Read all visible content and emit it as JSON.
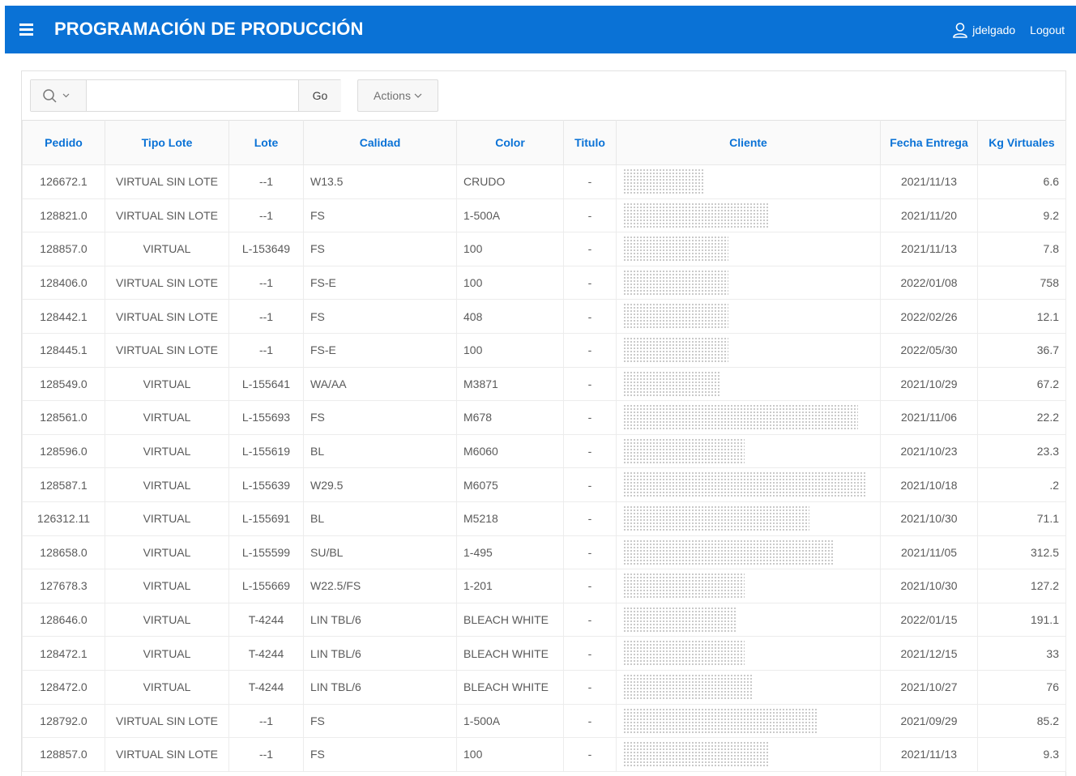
{
  "header": {
    "title": "PROGRAMACIÓN DE PRODUCCIÓN",
    "username": "jdelgado",
    "logout_label": "Logout"
  },
  "toolbar": {
    "search_value": "",
    "go_label": "Go",
    "actions_label": "Actions"
  },
  "table": {
    "columns": [
      "Pedido",
      "Tipo Lote",
      "Lote",
      "Calidad",
      "Color",
      "Titulo",
      "Cliente",
      "Fecha Entrega",
      "Kg Virtuales"
    ],
    "rows": [
      [
        "126672.1",
        "VIRTUAL SIN LOTE",
        "--1",
        "W13.5",
        "CRUDO",
        "-",
        "",
        "2021/11/13",
        "6.6"
      ],
      [
        "128821.0",
        "VIRTUAL SIN LOTE",
        "--1",
        "FS",
        "1-500A",
        "-",
        "",
        "2021/11/20",
        "9.2"
      ],
      [
        "128857.0",
        "VIRTUAL",
        "L-153649",
        "FS",
        "100",
        "-",
        "",
        "2021/11/13",
        "7.8"
      ],
      [
        "128406.0",
        "VIRTUAL SIN LOTE",
        "--1",
        "FS-E",
        "100",
        "-",
        "",
        "2022/01/08",
        "758"
      ],
      [
        "128442.1",
        "VIRTUAL SIN LOTE",
        "--1",
        "FS",
        "408",
        "-",
        "",
        "2022/02/26",
        "12.1"
      ],
      [
        "128445.1",
        "VIRTUAL SIN LOTE",
        "--1",
        "FS-E",
        "100",
        "-",
        "",
        "2022/05/30",
        "36.7"
      ],
      [
        "128549.0",
        "VIRTUAL",
        "L-155641",
        "WA/AA",
        "M3871",
        "-",
        "",
        "2021/10/29",
        "67.2"
      ],
      [
        "128561.0",
        "VIRTUAL",
        "L-155693",
        "FS",
        "M678",
        "-",
        "",
        "2021/11/06",
        "22.2"
      ],
      [
        "128596.0",
        "VIRTUAL",
        "L-155619",
        "BL",
        "M6060",
        "-",
        "",
        "2021/10/23",
        "23.3"
      ],
      [
        "128587.1",
        "VIRTUAL",
        "L-155639",
        "W29.5",
        "M6075",
        "-",
        "",
        "2021/10/18",
        ".2"
      ],
      [
        "126312.11",
        "VIRTUAL",
        "L-155691",
        "BL",
        "M5218",
        "-",
        "",
        "2021/10/30",
        "71.1"
      ],
      [
        "128658.0",
        "VIRTUAL",
        "L-155599",
        "SU/BL",
        "1-495",
        "-",
        "",
        "2021/11/05",
        "312.5"
      ],
      [
        "127678.3",
        "VIRTUAL",
        "L-155669",
        "W22.5/FS",
        "1-201",
        "-",
        "",
        "2021/10/30",
        "127.2"
      ],
      [
        "128646.0",
        "VIRTUAL",
        "T-4244",
        "LIN TBL/6",
        "BLEACH WHITE",
        "-",
        "",
        "2022/01/15",
        "191.1"
      ],
      [
        "128472.1",
        "VIRTUAL",
        "T-4244",
        "LIN TBL/6",
        "BLEACH WHITE",
        "-",
        "",
        "2021/12/15",
        "33"
      ],
      [
        "128472.0",
        "VIRTUAL",
        "T-4244",
        "LIN TBL/6",
        "BLEACH WHITE",
        "-",
        "",
        "2021/10/27",
        "76"
      ],
      [
        "128792.0",
        "VIRTUAL SIN LOTE",
        "--1",
        "FS",
        "1-500A",
        "-",
        "",
        "2021/09/29",
        "85.2"
      ],
      [
        "128857.0",
        "VIRTUAL SIN LOTE",
        "--1",
        "FS",
        "100",
        "-",
        "",
        "2021/11/13",
        "9.3"
      ]
    ]
  },
  "colors": {
    "header_bg": "#0a72d6",
    "link_blue": "#0a72d6"
  }
}
